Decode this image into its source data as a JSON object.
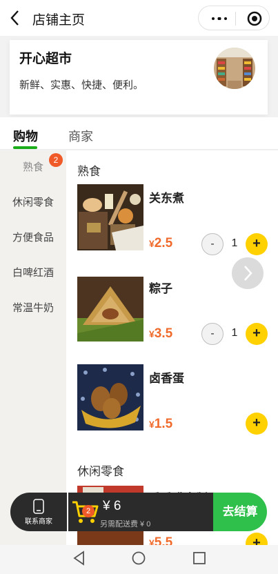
{
  "navbar": {
    "title": "店铺主页",
    "back_icon": "chevron-left-icon",
    "more_icon": "more-dots-icon",
    "close_icon": "target-circle-icon"
  },
  "store": {
    "name": "开心超市",
    "description": "新鲜、实惠、快捷、便利。"
  },
  "tabs": [
    {
      "label": "购物",
      "active": true
    },
    {
      "label": "商家",
      "active": false
    }
  ],
  "sidebar": {
    "categories": [
      {
        "label": "熟食",
        "active": true,
        "badge": "2"
      },
      {
        "label": "休闲零食",
        "active": false
      },
      {
        "label": "方便食品",
        "active": false
      },
      {
        "label": "白啤红酒",
        "active": false
      },
      {
        "label": "常温牛奶",
        "active": false
      }
    ]
  },
  "sections": [
    {
      "title": "熟食",
      "products": [
        {
          "name": "关东煮",
          "currency": "¥",
          "price": "2.5",
          "quantity": "1"
        },
        {
          "name": "粽子",
          "currency": "¥",
          "price": "3.5",
          "quantity": "1"
        },
        {
          "name": "卤香蛋",
          "currency": "¥",
          "price": "1.5",
          "quantity": ""
        }
      ]
    },
    {
      "title": "休闲零食",
      "products": [
        {
          "name": "香香嘴卤制豆干",
          "currency": "¥",
          "price": "5.5"
        }
      ]
    }
  ],
  "buttons": {
    "minus": "-",
    "plus": "+"
  },
  "contact": {
    "label": "联系商家",
    "icon": "phone-icon"
  },
  "cart": {
    "badge": "2",
    "total": "¥ 6",
    "delivery_note": "另需配送费 ¥ 0",
    "checkout_label": "去结算"
  },
  "colors": {
    "accent_green": "#1aad19",
    "checkout_green": "#2fbf4b",
    "price_orange": "#ef6a2b",
    "add_yellow": "#ffd100",
    "badge_red": "#f05a28"
  }
}
